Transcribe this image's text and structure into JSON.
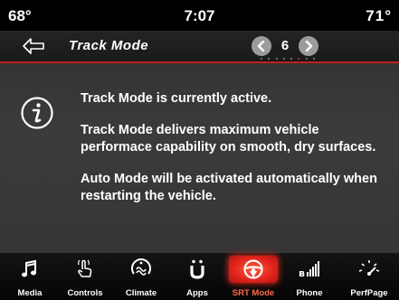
{
  "status": {
    "temp_left": "68°",
    "clock": "7:07",
    "temp_right": "71°"
  },
  "header": {
    "title": "Track Mode",
    "page_number": "6",
    "page_dots_total": 8,
    "page_dots_active_index": 5,
    "back_icon": "back-arrow-icon",
    "prev_icon": "chevron-left-icon",
    "next_icon": "chevron-right-icon"
  },
  "message": {
    "icon": "info-icon",
    "lines": [
      "Track Mode is currently active.",
      "Track Mode delivers maximum vehicle performace capability on smooth, dry surfaces.",
      "Auto Mode will be activated automatically when restarting the vehicle."
    ]
  },
  "nav": {
    "items": [
      {
        "label": "Media",
        "icon": "music-note-icon"
      },
      {
        "label": "Controls",
        "icon": "hand-touch-icon"
      },
      {
        "label": "Climate",
        "icon": "climate-icon"
      },
      {
        "label": "Apps",
        "icon": "apps-icon"
      },
      {
        "label": "SRT Mode",
        "icon": "steering-wheel-icon",
        "active": true
      },
      {
        "label": "Phone",
        "icon": "phone-signal-icon"
      },
      {
        "label": "PerfPage",
        "icon": "gauge-icon"
      }
    ]
  },
  "colors": {
    "accent_red": "#c41e1e",
    "active_nav": "#e0241c",
    "active_nav_label": "#ff6a4a",
    "arrow_gray": "#9c9c9c"
  }
}
